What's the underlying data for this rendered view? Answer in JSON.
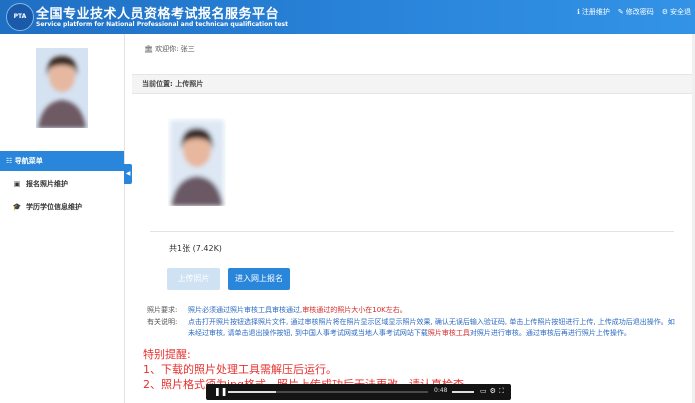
{
  "header": {
    "logo_text": "PTA",
    "title": "全国专业技术人员资格考试报名服务平台",
    "subtitle": "Service platform for National Professional and technican qualification test",
    "links": [
      {
        "icon": "info-icon",
        "glyph": "ℹ",
        "label": "注册维护"
      },
      {
        "icon": "edit-icon",
        "glyph": "✎",
        "label": "修改密码"
      },
      {
        "icon": "gear-icon",
        "glyph": "⚙",
        "label": "安全退"
      }
    ]
  },
  "welcome": {
    "icon_glyph": "🏛",
    "label": "欢迎你:",
    "name": "张三"
  },
  "sidebar": {
    "nav_header": "导航菜单",
    "nav_header_glyph": "☷",
    "items": [
      {
        "icon": "image-icon",
        "glyph": "▣",
        "label": "报名照片维护"
      },
      {
        "icon": "graduation-cap-icon",
        "glyph": "🎓",
        "label": "学历学位信息维护"
      }
    ],
    "collapse_glyph": "◀"
  },
  "breadcrumb": "当前位置: 上传照片",
  "photo_count": "共1张 (7.42K)",
  "buttons": {
    "upload": "上传照片",
    "apply": "进入网上报名"
  },
  "notes": {
    "req_label": "照片要求:",
    "req_text_a": "照片必须通过照片审核工具审核通过,",
    "req_text_b": "审核通过的照片大小在10K左右。",
    "info_label": "有关说明:",
    "info_text_a": "点击打开照片按钮选择照片文件, 通过审核照片将在照片显示区域显示照片效果, 确认无误后输入验证码, 单击上传照片按钮进行上传, 上传成功后退出操作。如未经过审核, 请单击退出操作按钮, 到中国人事考试网或当地人事考试网站下载",
    "info_text_b": "照片审核工具",
    "info_text_c": "对照片进行审核。通过审核后再进行照片上传操作。"
  },
  "reminder": {
    "title": "特别提醒:",
    "lines": [
      "1、下载的照片处理工具需解压后运行。",
      "2、照片格式须为jpg格式，照片上传成功后无法更改，请认真检查"
    ]
  },
  "video": {
    "pause_glyph": "❚❚",
    "time": "0:48",
    "progress": 0.24,
    "controls_glyph": "▭⚙⛶"
  },
  "colors": {
    "header_blue": "#2a86db",
    "reminder_red": "#e5312f",
    "note_blue": "#2b6ac2"
  }
}
